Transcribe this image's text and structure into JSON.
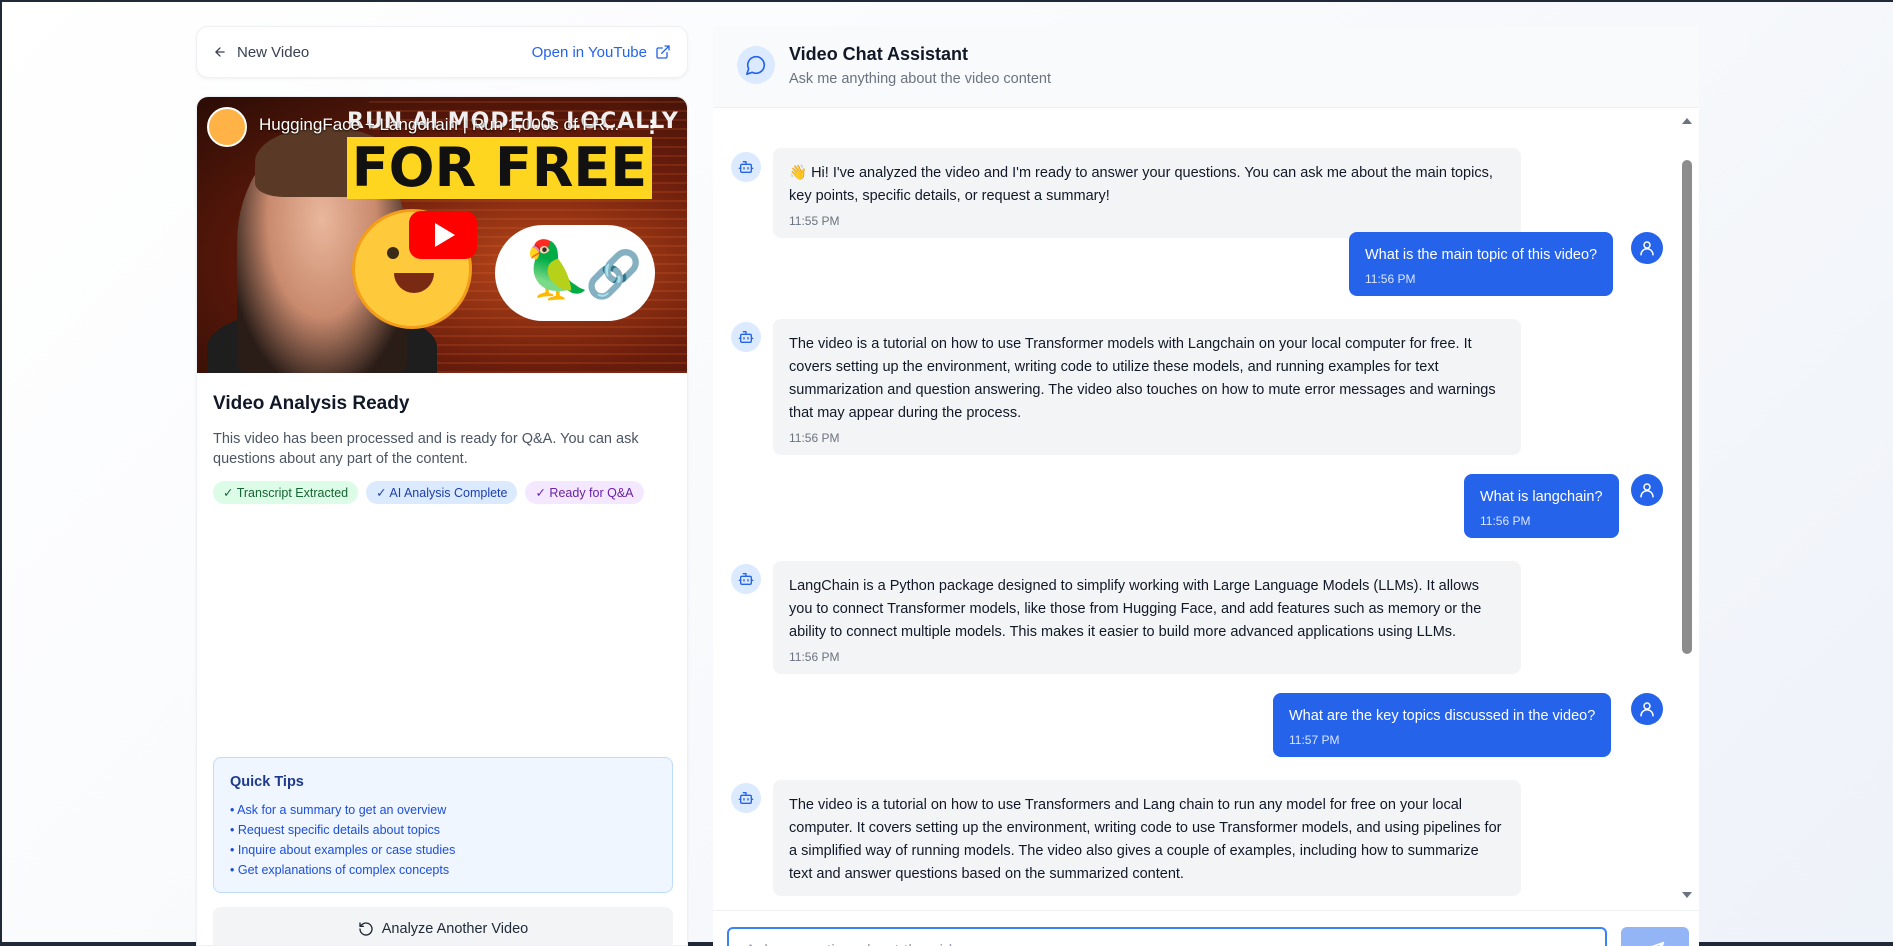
{
  "left_top": {
    "back_label": "New Video",
    "youtube_label": "Open in YouTube"
  },
  "video": {
    "title": "HuggingFace + Langchain | Run 1,000s of FR...",
    "thumb_line1": "RUN AI MODELS LOCALLY",
    "thumb_line2": "FOR FREE"
  },
  "card": {
    "title": "Video Analysis Ready",
    "description": "This video has been processed and is ready for Q&A. You can ask questions about any part of the content.",
    "badges": [
      "✓ Transcript Extracted",
      "✓ AI Analysis Complete",
      "✓ Ready for Q&A"
    ]
  },
  "tips": {
    "title": "Quick Tips",
    "items": [
      "• Ask for a summary to get an overview",
      "• Request specific details about topics",
      "• Inquire about examples or case studies",
      "• Get explanations of complex concepts"
    ]
  },
  "analyze_button": "Analyze Another Video",
  "chat": {
    "title": "Video Chat Assistant",
    "subtitle": "Ask me anything about the video content",
    "messages": [
      {
        "role": "bot",
        "text": "👋 Hi! I've analyzed the video and I'm ready to answer your questions. You can ask me about the main topics, key points, specific details, or request a summary!",
        "time": "11:55 PM"
      },
      {
        "role": "user",
        "text": "What is the main topic of this video?",
        "time": "11:56 PM"
      },
      {
        "role": "bot",
        "text": "The video is a tutorial on how to use Transformer models with Langchain on your local computer for free. It covers setting up the environment, writing code to utilize these models, and running examples for text summarization and question answering. The video also touches on how to mute error messages and warnings that may appear during the process.",
        "time": "11:56 PM"
      },
      {
        "role": "user",
        "text": "What is langchain?",
        "time": "11:56 PM"
      },
      {
        "role": "bot",
        "text": "LangChain is a Python package designed to simplify working with Large Language Models (LLMs). It allows you to connect Transformer models, like those from Hugging Face, and add features such as memory or the ability to connect multiple models. This makes it easier to build more advanced applications using LLMs.",
        "time": "11:56 PM"
      },
      {
        "role": "user",
        "text": "What are the key topics discussed in the video?",
        "time": "11:57 PM"
      },
      {
        "role": "bot",
        "text": "The video is a tutorial on how to use Transformers and Lang chain to run any model for free on your local computer. It covers setting up the environment, writing code to use Transformer models, and using pipelines for a simplified way of running models. The video also gives a couple of examples, including how to summarize text and answer questions based on the summarized content.",
        "time": ""
      }
    ],
    "input_placeholder": "Ask a question about the video..."
  },
  "colors": {
    "accent": "#2563eb",
    "bot_bubble": "#f3f4f6",
    "send_disabled": "#93b4f5"
  },
  "icons": {
    "back": "arrow-left-icon",
    "external": "external-link-icon",
    "chat": "message-circle-icon",
    "bot": "bot-icon",
    "user": "user-icon",
    "refresh": "rotate-ccw-icon",
    "send": "send-icon"
  }
}
